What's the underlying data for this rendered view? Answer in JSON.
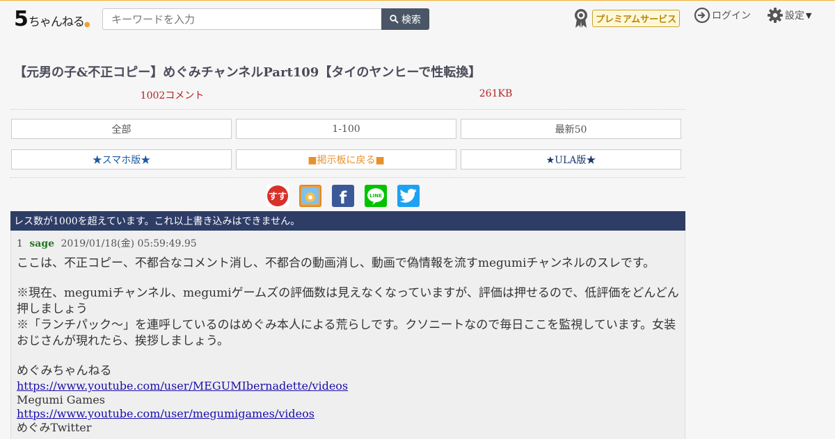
{
  "header": {
    "logo_main": "5",
    "logo_text": "ちゃんねる",
    "search_placeholder": "キーワードを入力",
    "search_button": "検索",
    "premium_label": "プレミアムサービス",
    "login_label": "ログイン",
    "settings_label": "設定"
  },
  "thread": {
    "title": "【元男の子&不正コピー】めぐみチャンネルPart109【タイのヤンヒーで性転換】",
    "comment_count": "1002コメント",
    "size": "261KB"
  },
  "nav_buttons": [
    {
      "label": "全部",
      "color": "#555555"
    },
    {
      "label": "1-100",
      "color": "#555555"
    },
    {
      "label": "最新50",
      "color": "#555555"
    },
    {
      "label": "★スマホ版★",
      "color": "#1a5aa0"
    },
    {
      "label": "■掲示板に戻る■",
      "color": "#e8912c"
    },
    {
      "label": "★ULA版★",
      "color": "#1a3a70"
    }
  ],
  "share": [
    {
      "name": "5ch-share-icon",
      "text": "すす",
      "color": "#d9302a"
    },
    {
      "name": "bookmark-share-icon",
      "text": "",
      "color": "#f0a040"
    },
    {
      "name": "facebook-icon",
      "text": "f",
      "color": "#3b5998"
    },
    {
      "name": "line-icon",
      "text": "LINE",
      "color": "#00c300"
    },
    {
      "name": "twitter-icon",
      "text": "",
      "color": "#1da1f2"
    }
  ],
  "notice": "レス数が1000を超えています。これ以上書き込みはできません。",
  "post": {
    "number": "1",
    "name": "sage",
    "date": "2019/01/18(金) 05:59:49.95",
    "lines": {
      "l1": "ここは、不正コピー、不都合なコメント消し、不都合の動画消し、動画で偽情報を流すmegumiチャンネルのスレです。",
      "l2": "※現在、megumiチャンネル、megumiゲームズの評価数は見えなくなっていますが、評価は押せるので、低評価をどんどん押しましょう",
      "l3": "※「ランチパック～」を連呼しているのはめぐみ本人による荒らしです。クソニートなので毎日ここを監視しています。女装おじさんが現れたら、挨拶しましょう。",
      "l4": "めぐみちゃんねる",
      "link1": "https://www.youtube.com/user/MEGUMIbernadette/videos",
      "l5": "Megumi Games",
      "link2": "https://www.youtube.com/user/megumigames/videos",
      "l6": "めぐみTwitter"
    }
  }
}
